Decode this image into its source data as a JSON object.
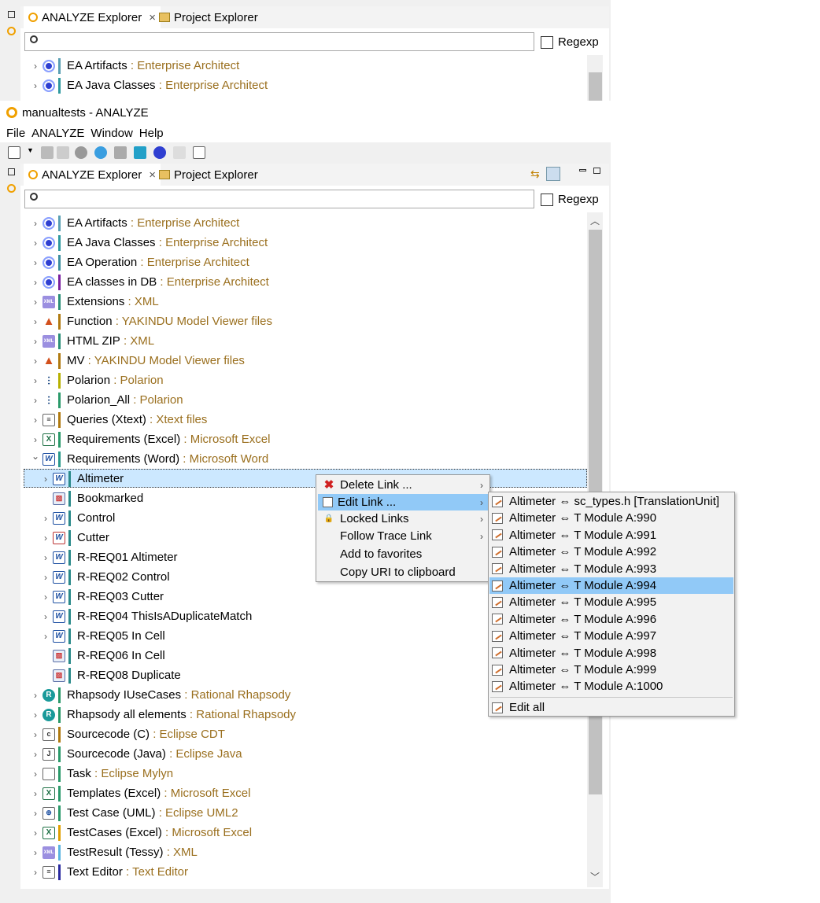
{
  "window_title": "manualtests - ANALYZE",
  "menubar": [
    "File",
    "ANALYZE",
    "Window",
    "Help"
  ],
  "tabs": {
    "analyze_label": "ANALYZE Explorer",
    "project_label": "Project Explorer"
  },
  "search": {
    "placeholder": "",
    "regexp_label": "Regexp"
  },
  "ghost_rows": [
    {
      "name": "EA Artifacts",
      "source": " : Enterprise Architect"
    },
    {
      "name": "EA Java Classes",
      "source": " : Enterprise Architect"
    }
  ],
  "tree": [
    {
      "name": "EA Artifacts",
      "source": " : Enterprise Architect",
      "icon": "ea-icon",
      "bar": "#5aa0b4"
    },
    {
      "name": "EA Java Classes",
      "source": " : Enterprise Architect",
      "icon": "ea-icon",
      "bar": "#2f9aa0"
    },
    {
      "name": "EA Operation",
      "source": " : Enterprise Architect",
      "icon": "ea-icon",
      "bar": "#3c8f9f"
    },
    {
      "name": "EA classes in DB",
      "source": " : Enterprise Architect",
      "icon": "ea-icon",
      "bar": "#7a1fa0"
    },
    {
      "name": "Extensions",
      "source": " : XML",
      "icon": "xml-icon",
      "bar": "#2a8f77"
    },
    {
      "name": "Function",
      "source": " : YAKINDU Model Viewer files",
      "icon": "matlab-icon",
      "bar": "#b07a10"
    },
    {
      "name": "HTML ZIP",
      "source": " : XML",
      "icon": "xml-icon",
      "bar": "#2a8f77"
    },
    {
      "name": "MV",
      "source": " : YAKINDU Model Viewer files",
      "icon": "matlab-icon",
      "bar": "#b07a10"
    },
    {
      "name": "Polarion",
      "source": " : Polarion",
      "icon": "polarion-icon",
      "bar": "#b7b000"
    },
    {
      "name": "Polarion_All",
      "source": " : Polarion",
      "icon": "polarion-icon",
      "bar": "#2a9a6a"
    },
    {
      "name": "Queries (Xtext)",
      "source": " : Xtext files",
      "icon": "xtext-icon",
      "bar": "#b07a10"
    },
    {
      "name": "Requirements (Excel)",
      "source": " : Microsoft Excel",
      "icon": "excel-icon",
      "bar": "#2a9a6a"
    },
    {
      "name": "Requirements (Word)",
      "source": " : Microsoft Word",
      "icon": "word-icon",
      "bar": "#2a9a8a",
      "expanded": true
    }
  ],
  "children": [
    {
      "name": "Altimeter",
      "icon": "word-icon",
      "expandable": true,
      "selected": true
    },
    {
      "name": "Bookmarked",
      "icon": "word-image-icon",
      "expandable": false
    },
    {
      "name": "Control",
      "icon": "word-icon",
      "expandable": true
    },
    {
      "name": "Cutter",
      "icon": "word-red-icon",
      "expandable": true
    },
    {
      "name": "R-REQ01 Altimeter",
      "icon": "word-icon",
      "expandable": true
    },
    {
      "name": "R-REQ02 Control",
      "icon": "word-icon",
      "expandable": true
    },
    {
      "name": "R-REQ03 Cutter",
      "icon": "word-icon",
      "expandable": true
    },
    {
      "name": "R-REQ04 ThisIsADuplicateMatch",
      "icon": "word-icon",
      "expandable": true
    },
    {
      "name": "R-REQ05 In Cell",
      "icon": "word-icon",
      "expandable": true
    },
    {
      "name": "R-REQ06 In Cell",
      "icon": "word-image-icon",
      "expandable": false
    },
    {
      "name": "R-REQ08 Duplicate",
      "icon": "word-image-icon",
      "expandable": false
    }
  ],
  "tree_after": [
    {
      "name": "Rhapsody IUseCases",
      "source": " : Rational Rhapsody",
      "icon": "rhapsody-icon",
      "bar": "#2a9a6a"
    },
    {
      "name": "Rhapsody all elements",
      "source": " : Rational Rhapsody",
      "icon": "rhapsody-icon",
      "bar": "#2a9a6a"
    },
    {
      "name": "Sourcecode (C)",
      "source": " : Eclipse CDT",
      "icon": "c-file-icon",
      "bar": "#b07a10"
    },
    {
      "name": "Sourcecode (Java)",
      "source": " : Eclipse Java",
      "icon": "java-file-icon",
      "bar": "#2a9a6a"
    },
    {
      "name": "Task",
      "source": " : Eclipse Mylyn",
      "icon": "clipboard-icon",
      "bar": "#2a9a6a"
    },
    {
      "name": "Templates (Excel)",
      "source": " : Microsoft Excel",
      "icon": "excel-icon",
      "bar": "#2a9a6a"
    },
    {
      "name": "Test Case (UML)",
      "source": " : Eclipse UML2",
      "icon": "uml-icon",
      "bar": "#2a9a6a"
    },
    {
      "name": "TestCases (Excel)",
      "source": " : Microsoft Excel",
      "icon": "excel-icon",
      "bar": "#e0a000"
    },
    {
      "name": "TestResult (Tessy)",
      "source": " : XML",
      "icon": "xml-icon",
      "bar": "#5ab4e0"
    },
    {
      "name": "Text Editor",
      "source": " : Text Editor",
      "icon": "text-file-icon",
      "bar": "#2a2aa0"
    }
  ],
  "context_menu": [
    {
      "label": "Delete Link ...",
      "icon": "delete-icon",
      "submenu": true
    },
    {
      "label": "Edit Link ...",
      "icon": "edit-icon",
      "submenu": true,
      "highlighted": true
    },
    {
      "label": "Locked Links",
      "icon": "lock-icon",
      "submenu": true
    },
    {
      "label": "Follow Trace Link",
      "icon": "",
      "submenu": true
    },
    {
      "label": "Add to favorites",
      "icon": "",
      "submenu": false
    },
    {
      "label": "Copy URI to clipboard",
      "icon": "",
      "submenu": false
    }
  ],
  "submenu": [
    {
      "label": "Altimeter ⇔ sc_types.h [TranslationUnit]"
    },
    {
      "label": "Altimeter ⇔ T Module A:990"
    },
    {
      "label": "Altimeter ⇔ T Module A:991"
    },
    {
      "label": "Altimeter ⇔ T Module A:992"
    },
    {
      "label": "Altimeter ⇔ T Module A:993"
    },
    {
      "label": "Altimeter ⇔ T Module A:994",
      "highlighted": true
    },
    {
      "label": "Altimeter ⇔ T Module A:995"
    },
    {
      "label": "Altimeter ⇔ T Module A:996"
    },
    {
      "label": "Altimeter ⇔ T Module A:997"
    },
    {
      "label": "Altimeter ⇔ T Module A:998"
    },
    {
      "label": "Altimeter ⇔ T Module A:999"
    },
    {
      "label": "Altimeter ⇔ T Module A:1000"
    }
  ],
  "submenu_footer": "Edit all"
}
